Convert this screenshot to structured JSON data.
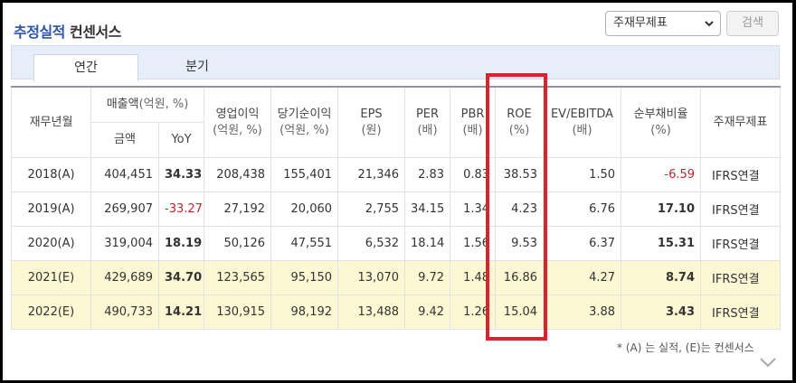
{
  "header": {
    "title_blue": "추정실적",
    "title_dark": "컨센서스",
    "select_value": "주재무제표",
    "search_label": "검색"
  },
  "tabs": [
    {
      "label": "연간",
      "active": true
    },
    {
      "label": "분기",
      "active": false
    }
  ],
  "table": {
    "headers": {
      "year": "재무년월",
      "revenue": "매출액",
      "revenue_unit": "(억원, %)",
      "revenue_amount": "금액",
      "revenue_yoy": "YoY",
      "op_income": "영업이익",
      "op_income_unit": "(억원, %)",
      "net_income": "당기순이익",
      "net_income_unit": "(억원, %)",
      "eps": "EPS",
      "eps_unit": "(원)",
      "per": "PER",
      "per_unit": "(배)",
      "pbr": "PBR",
      "pbr_unit": "(배)",
      "roe": "ROE",
      "roe_unit": "(%)",
      "ev_ebitda": "EV/EBITDA",
      "ev_ebitda_unit": "(배)",
      "debt": "순부채비율",
      "debt_unit": "(%)",
      "statement": "주재무제표"
    },
    "rows": [
      {
        "year": "2018(A)",
        "revenue": "404,451",
        "yoy": "34.33",
        "op": "208,438",
        "net": "155,401",
        "eps": "21,346",
        "per": "2.83",
        "pbr": "0.83",
        "roe": "38.53",
        "ev": "1.50",
        "debt": "-6.59",
        "std": "IFRS연결"
      },
      {
        "year": "2019(A)",
        "revenue": "269,907",
        "yoy": "-33.27",
        "op": "27,192",
        "net": "20,060",
        "eps": "2,755",
        "per": "34.15",
        "pbr": "1.34",
        "roe": "4.23",
        "ev": "6.76",
        "debt": "17.10",
        "std": "IFRS연결"
      },
      {
        "year": "2020(A)",
        "revenue": "319,004",
        "yoy": "18.19",
        "op": "50,126",
        "net": "47,551",
        "eps": "6,532",
        "per": "18.14",
        "pbr": "1.56",
        "roe": "9.53",
        "ev": "6.37",
        "debt": "15.31",
        "std": "IFRS연결"
      },
      {
        "year": "2021(E)",
        "revenue": "429,689",
        "yoy": "34.70",
        "op": "123,565",
        "net": "95,150",
        "eps": "13,070",
        "per": "9.72",
        "pbr": "1.48",
        "roe": "16.86",
        "ev": "4.27",
        "debt": "8.74",
        "std": "IFRS연결"
      },
      {
        "year": "2022(E)",
        "revenue": "490,733",
        "yoy": "14.21",
        "op": "130,915",
        "net": "98,192",
        "eps": "13,488",
        "per": "9.42",
        "pbr": "1.26",
        "roe": "15.04",
        "ev": "3.88",
        "debt": "3.43",
        "std": "IFRS연결"
      }
    ]
  },
  "footnote": "* (A) 는 실적, (E)는 컨센서스",
  "colors": {
    "title_blue": "#2b55a6",
    "negative_red": "#c0262b",
    "estimate_bg": "#fcf8d4",
    "highlight_box": "#e0202a"
  }
}
